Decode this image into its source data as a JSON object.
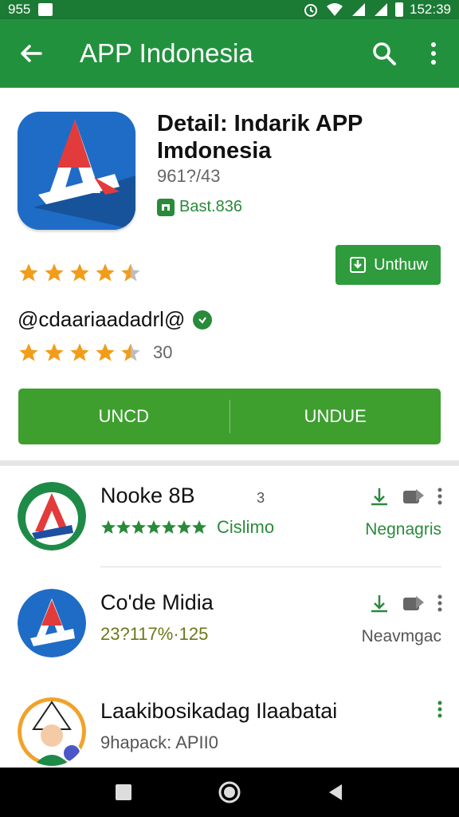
{
  "status_bar": {
    "left_text": "955",
    "time": "152:39"
  },
  "app_bar": {
    "title": "APP Indonesia",
    "icons": [
      "back-arrow-icon",
      "search-icon",
      "more-vert-icon"
    ]
  },
  "detail": {
    "title": "Detail: Indarik APP Imdonesia",
    "subtitle": "961?/43",
    "badge_text": "Bast.836",
    "install_label": "Unthuw",
    "developer": "@cdaariaadadrl@",
    "rating_count": "30",
    "button_left": "UNCD",
    "button_right": "UNDUE"
  },
  "list": [
    {
      "name": "Nooke 8B",
      "extra": "3",
      "meta": "Cislimo",
      "status": "Negnagris"
    },
    {
      "name": "Co'de Midia",
      "meta": "23?117%·125",
      "status": "Neavmgac"
    },
    {
      "name": "Laakibosikadag Ilaabatai",
      "meta": "9hapack: APII0",
      "status": ""
    }
  ],
  "colors": {
    "primary": "#22913e",
    "accent": "#2a8a3b",
    "star": "#f39c1a",
    "icon_blue": "#1f6cc6"
  }
}
